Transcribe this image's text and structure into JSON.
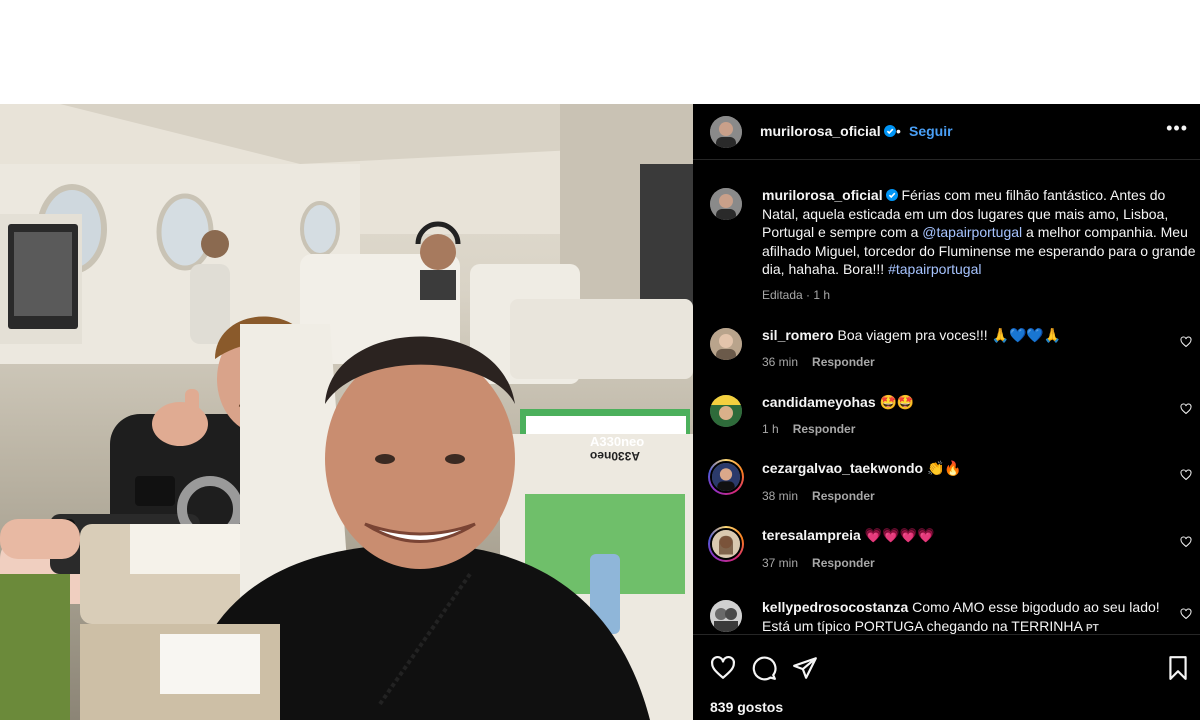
{
  "post": {
    "author": "murilorosa_oficial",
    "separator": "•",
    "follow_label": "Seguir",
    "more_label": "•••",
    "caption_parts": {
      "text1": " Férias com meu filhão fantástico. Antes do Natal, aquela esticada em um dos lugares que mais amo, Lisboa, Portugal e sempre com a ",
      "mention": "@tapairportugal",
      "text2": " a melhor companhia. Meu afilhado Miguel, torcedor do Fluminense me esperando para o grande dia, hahaha. Bora!!! ",
      "hashtag": "#tapairportugal"
    },
    "edited": "Editada",
    "time": "1 h",
    "likes": "839 gostos",
    "photo_labels": [
      "A330neo",
      "A330neo"
    ]
  },
  "comments": [
    {
      "user": "sil_romero",
      "text": "Boa viagem pra voces!!! 🙏💙💙🙏",
      "time": "36 min",
      "reply": "Responder"
    },
    {
      "user": "candidameyohas",
      "text": "🤩🤩",
      "time": "1 h",
      "reply": "Responder"
    },
    {
      "user": "cezargalvao_taekwondo",
      "text": "👏🔥",
      "time": "38 min",
      "reply": "Responder"
    },
    {
      "user": "teresalampreia",
      "text": "💗💗💗💗",
      "time": "37 min",
      "reply": "Responder"
    },
    {
      "user": "kellypedrosocostanza",
      "text": "Como AMO esse bigodudo ao seu lado! Está um típico PORTUGA chegando na TERRINHA",
      "tag": "PT"
    }
  ],
  "icons": {
    "like": "heart-icon",
    "comment": "comment-icon",
    "share": "share-icon",
    "save": "bookmark-icon",
    "verified": "verified-badge-icon"
  },
  "colors": {
    "panel_bg": "#000000",
    "link": "#a7c4ff",
    "follow": "#4a9ff5",
    "muted": "#a8a8a8"
  }
}
